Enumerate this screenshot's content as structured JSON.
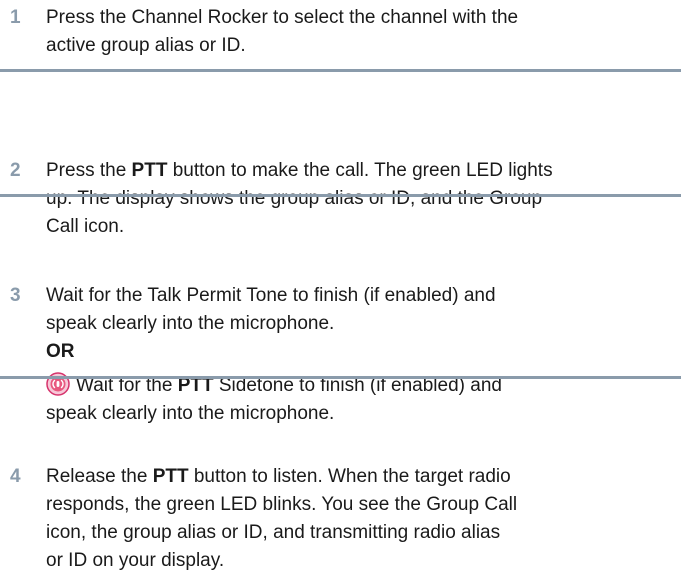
{
  "steps": [
    {
      "number": "1",
      "lines": [
        "Press the Channel Rocker to select the channel with the",
        "active group alias or ID."
      ]
    },
    {
      "number": "2",
      "line1_pre": "Press the ",
      "line1_bold": "PTT",
      "line1_post": " button to make the call. The green LED lights",
      "line2": "up. The display shows the group alias or ID, and the Group",
      "line3": "Call icon."
    },
    {
      "number": "3",
      "line1": "Wait for the Talk Permit Tone to finish (if enabled) and",
      "line2": "speak clearly into the microphone.",
      "or": "OR",
      "alt_pre": "Wait for the ",
      "alt_bold": "PTT",
      "alt_post": " Sidetone to finish (if enabled) and",
      "alt_line2": "speak clearly into the microphone.",
      "alt_icon": "sidetone-icon"
    },
    {
      "number": "4",
      "line1_pre": "Release the ",
      "line1_bold": "PTT",
      "line1_post": " button to listen. When the target radio",
      "line2": "responds, the green LED blinks. You see the Group Call",
      "line3": "icon, the group alias or ID, and transmitting radio alias",
      "line4": "or ID on your display."
    }
  ],
  "colors": {
    "accent": "#8a9bab",
    "icon_fill": "#d6336c",
    "icon_bg": "#f7c8d8"
  }
}
